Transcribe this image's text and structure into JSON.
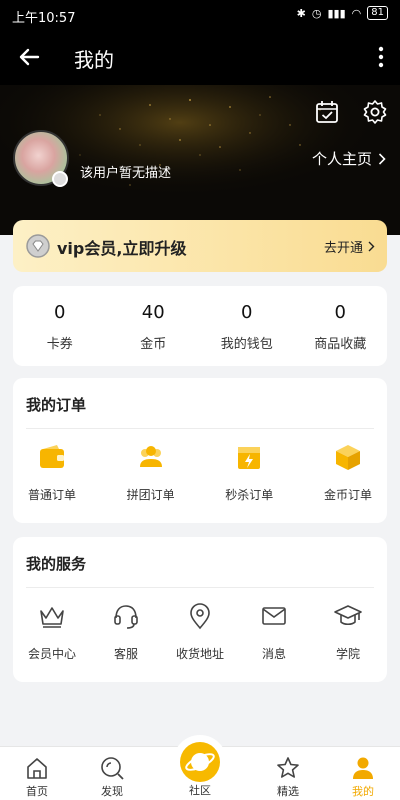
{
  "status_bar": {
    "time": "上午10:57",
    "battery": "81"
  },
  "app_bar": {
    "title": "我的"
  },
  "profile": {
    "description": "该用户暂无描述",
    "profile_link": "个人主页"
  },
  "vip": {
    "text": "vip会员,立即升级",
    "action": "去开通"
  },
  "stats": [
    {
      "value": "0",
      "label": "卡券"
    },
    {
      "value": "40",
      "label": "金币"
    },
    {
      "value": "0",
      "label": "我的钱包"
    },
    {
      "value": "0",
      "label": "商品收藏"
    }
  ],
  "orders": {
    "title": "我的订单",
    "items": [
      {
        "label": "普通订单",
        "icon": "wallet-icon"
      },
      {
        "label": "拼团订单",
        "icon": "group-icon"
      },
      {
        "label": "秒杀订单",
        "icon": "flash-sale-icon"
      },
      {
        "label": "金币订单",
        "icon": "package-icon"
      }
    ]
  },
  "services": {
    "title": "我的服务",
    "items": [
      {
        "label": "会员中心",
        "icon": "crown-icon"
      },
      {
        "label": "客服",
        "icon": "headset-icon"
      },
      {
        "label": "收货地址",
        "icon": "location-icon"
      },
      {
        "label": "消息",
        "icon": "mail-icon"
      },
      {
        "label": "学院",
        "icon": "graduation-cap-icon"
      }
    ]
  },
  "tabs": [
    {
      "label": "首页",
      "icon": "home-icon"
    },
    {
      "label": "发现",
      "icon": "discover-icon"
    },
    {
      "label": "社区",
      "icon": "planet-icon"
    },
    {
      "label": "精选",
      "icon": "star-icon"
    },
    {
      "label": "我的",
      "icon": "user-icon"
    }
  ],
  "colors": {
    "accent": "#f2a900",
    "vip_gradient_start": "#fdf0c6",
    "vip_gradient_end": "#f9dc92",
    "background": "#f2f3f5"
  }
}
